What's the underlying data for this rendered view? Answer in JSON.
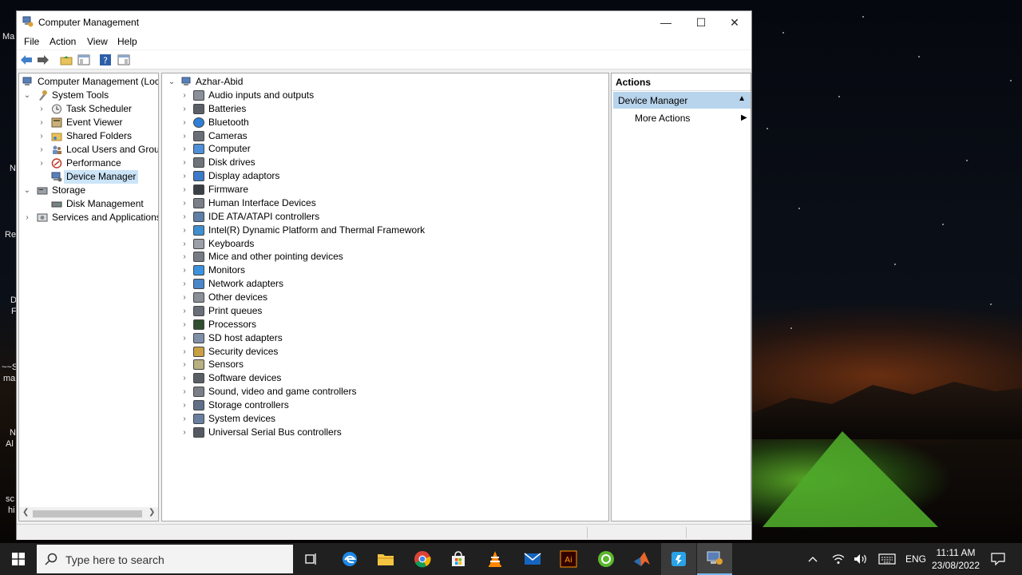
{
  "window": {
    "title": "Computer Management",
    "controls": {
      "minimize": "—",
      "maximize": "☐",
      "close": "✕"
    }
  },
  "menu": [
    "File",
    "Action",
    "View",
    "Help"
  ],
  "tree": {
    "root": "Computer Management (Local",
    "system_tools": "System Tools",
    "system_items": [
      "Task Scheduler",
      "Event Viewer",
      "Shared Folders",
      "Local Users and Groups",
      "Performance",
      "Device Manager"
    ],
    "storage": "Storage",
    "storage_items": [
      "Disk Management"
    ],
    "services": "Services and Applications",
    "selected": "Device Manager"
  },
  "devices": {
    "root": "Azhar-Abid",
    "items": [
      "Audio inputs and outputs",
      "Batteries",
      "Bluetooth",
      "Cameras",
      "Computer",
      "Disk drives",
      "Display adaptors",
      "Firmware",
      "Human Interface Devices",
      "IDE ATA/ATAPI controllers",
      "Intel(R) Dynamic Platform and Thermal Framework",
      "Keyboards",
      "Mice and other pointing devices",
      "Monitors",
      "Network adapters",
      "Other devices",
      "Print queues",
      "Processors",
      "SD host adapters",
      "Security devices",
      "Sensors",
      "Software devices",
      "Sound, video and game controllers",
      "Storage controllers",
      "System devices",
      "Universal Serial Bus controllers"
    ]
  },
  "actions": {
    "title": "Actions",
    "section": "Device Manager",
    "items": [
      "More Actions"
    ]
  },
  "taskbar": {
    "search_placeholder": "Type here to search",
    "language": "ENG",
    "time": "11:11 AM",
    "date": "23/08/2022"
  },
  "desktop_fragments": [
    "Ma",
    "N",
    "Re",
    "D",
    "F",
    "~~S",
    "ma",
    "N",
    "Al",
    "sc",
    "hi"
  ]
}
